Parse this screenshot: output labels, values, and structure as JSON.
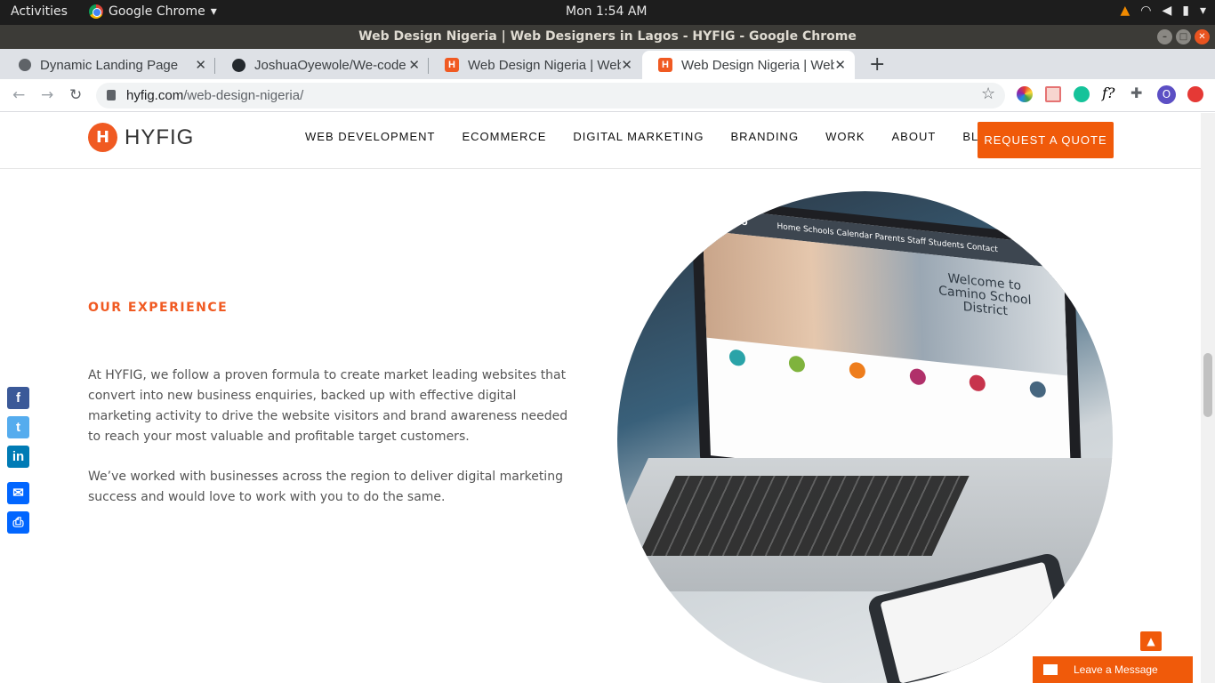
{
  "os": {
    "activities": "Activities",
    "app_name": "Google Chrome",
    "clock": "Mon  1:54 AM"
  },
  "window": {
    "title": "Web Design Nigeria | Web Designers in Lagos - HYFIG - Google Chrome"
  },
  "tabs": [
    {
      "label": "Dynamic Landing Page",
      "icon": "globe-icon"
    },
    {
      "label": "JoshuaOyewole/We-code",
      "icon": "github-icon"
    },
    {
      "label": "Web Design Nigeria | Web",
      "icon": "hyfig-favicon"
    },
    {
      "label": "Web Design Nigeria | Web",
      "icon": "hyfig-favicon",
      "active": true
    }
  ],
  "address": {
    "domain": "hyfig.com",
    "path": "/web-design-nigeria/"
  },
  "extensions": {
    "avatar_letter": "O",
    "formula_label": "f?"
  },
  "site": {
    "logo_text": "HYFIG",
    "nav": [
      "WEB DEVELOPMENT",
      "ECOMMERCE",
      "DIGITAL MARKETING",
      "BRANDING",
      "WORK",
      "ABOUT",
      "BLOG"
    ],
    "cta": "REQUEST A QUOTE"
  },
  "content": {
    "heading": "OUR EXPERIENCE",
    "para1": "At HYFIG, we follow a proven formula to create market leading websites that convert into new business enquiries, backed up with effective digital marketing activity to drive the website visitors and brand awareness needed to reach your most valuable and profitable target customers.",
    "para2": "We’ve worked with businesses across the region to deliver digital marketing success and would love to work with you to do the same."
  },
  "hero_image": {
    "brand": "CAMINO",
    "menu": "Home   Schools   Calendar   Parents   Staff   Students   Contact",
    "headline": "Welcome to Camino School District"
  },
  "share": [
    "facebook-icon",
    "twitter-icon",
    "linkedin-icon",
    "email-icon",
    "print-icon"
  ],
  "chat": {
    "label": "Leave a Message"
  },
  "colors": {
    "brand_orange": "#f05a0a",
    "heading_orange": "#f05a22"
  }
}
